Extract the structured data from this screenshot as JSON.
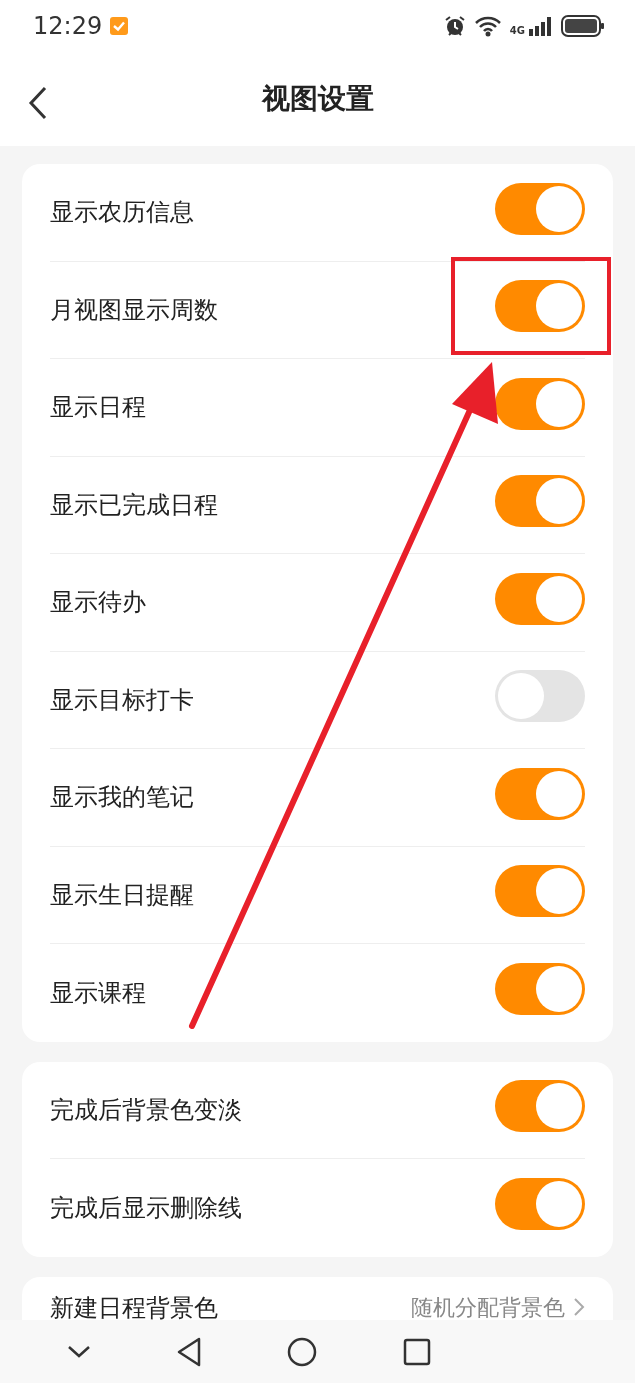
{
  "status_bar": {
    "time": "12:29",
    "network": "4G"
  },
  "header": {
    "title": "视图设置"
  },
  "groups": [
    {
      "rows": [
        {
          "label": "显示农历信息",
          "on": true
        },
        {
          "label": "月视图显示周数",
          "on": true,
          "highlighted": true
        },
        {
          "label": "显示日程",
          "on": true
        },
        {
          "label": "显示已完成日程",
          "on": true
        },
        {
          "label": "显示待办",
          "on": true
        },
        {
          "label": "显示目标打卡",
          "on": false
        },
        {
          "label": "显示我的笔记",
          "on": true
        },
        {
          "label": "显示生日提醒",
          "on": true
        },
        {
          "label": "显示课程",
          "on": true
        }
      ]
    },
    {
      "rows": [
        {
          "label": "完成后背景色变淡",
          "on": true
        },
        {
          "label": "完成后显示删除线",
          "on": true
        }
      ]
    },
    {
      "rows": [
        {
          "label": "新建日程背景色",
          "value": "随机分配背景色"
        }
      ]
    }
  ]
}
